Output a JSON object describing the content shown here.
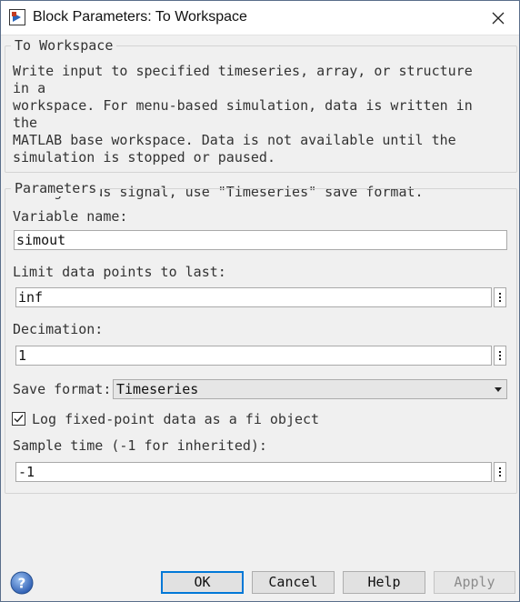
{
  "window": {
    "title": "Block Parameters: To Workspace",
    "icon": "simulink-block-icon",
    "close_icon": "close-icon"
  },
  "description_group": {
    "legend": "To Workspace",
    "text": "Write input to specified timeseries, array, or structure in a\nworkspace. For menu-based simulation, data is written in the\nMATLAB base workspace. Data is not available until the\nsimulation is stopped or paused.\n\nTo log a bus signal, use \"Timeseries\" save format."
  },
  "parameters": {
    "legend": "Parameters",
    "variable_name": {
      "label": "Variable name:",
      "value": "simout"
    },
    "limit_data_points": {
      "label": "Limit data points to last:",
      "value": "inf"
    },
    "decimation": {
      "label": "Decimation:",
      "value": "1"
    },
    "save_format": {
      "label": "Save format:",
      "value": "Timeseries"
    },
    "log_fixed_point": {
      "label": "Log fixed-point data as a fi object",
      "checked": true
    },
    "sample_time": {
      "label": "Sample time (-1 for inherited):",
      "value": "-1"
    }
  },
  "buttons": {
    "ok": "OK",
    "cancel": "Cancel",
    "help": "Help",
    "apply": "Apply"
  },
  "colors": {
    "accent": "#0078d7",
    "background": "#f0f0f0",
    "help_icon": "#3b6fc0"
  }
}
